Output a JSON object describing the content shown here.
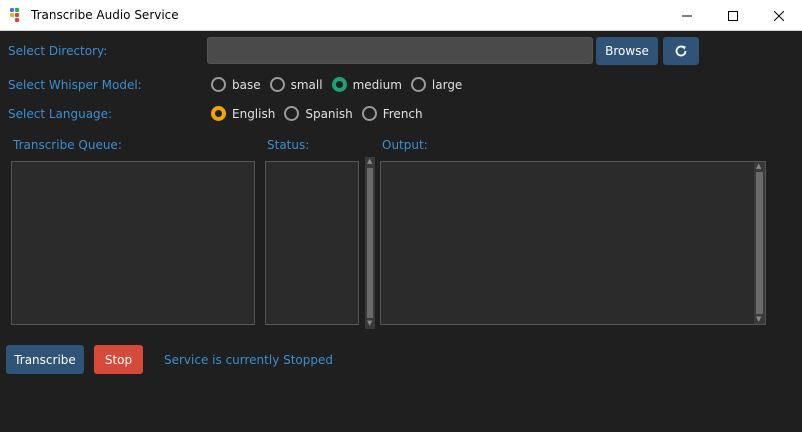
{
  "window": {
    "title": "Transcribe Audio Service",
    "controls": {
      "minimize": "minimize-icon",
      "maximize": "maximize-icon",
      "close": "close-icon"
    }
  },
  "form": {
    "directory_label": "Select Directory:",
    "directory_value": "",
    "browse_label": "Browse",
    "refresh_icon": "refresh-icon",
    "model_label": "Select Whisper Model:",
    "models": [
      "base",
      "small",
      "medium",
      "large"
    ],
    "selected_model": "medium",
    "language_label": "Select Language:",
    "languages": [
      "English",
      "Spanish",
      "French"
    ],
    "selected_language": "English"
  },
  "panels": {
    "queue_label": "Transcribe Queue:",
    "status_label": "Status:",
    "output_label": "Output:"
  },
  "actions": {
    "transcribe_label": "Transcribe",
    "stop_label": "Stop",
    "service_status": "Service is currently Stopped"
  },
  "colors": {
    "accent_text": "#3b8ed0",
    "button_blue": "#2f5478",
    "stop_red": "#d64a3a",
    "model_radio": "#1f9f74",
    "language_radio": "#f0a500",
    "background": "#1f1f1f"
  }
}
